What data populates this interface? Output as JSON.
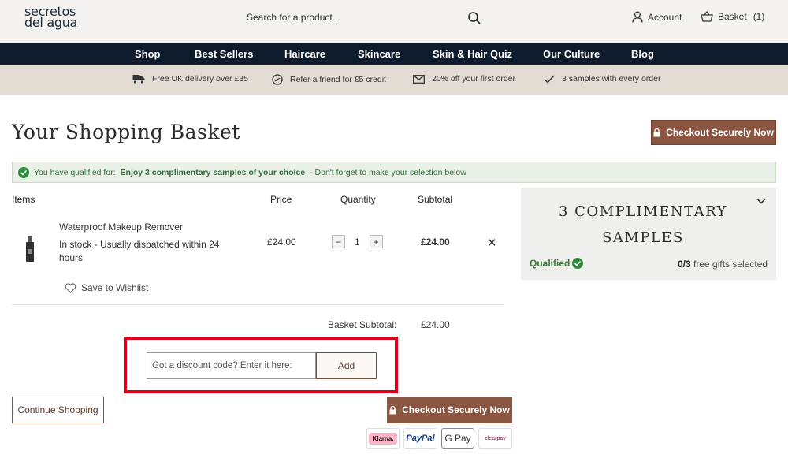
{
  "header": {
    "logo_line1": "secretos",
    "logo_line2": "del agua",
    "search_placeholder": "Search for a product...",
    "account_label": "Account",
    "basket_label": "Basket",
    "basket_count": "(1)"
  },
  "nav": {
    "items": [
      "Shop",
      "Best Sellers",
      "Haircare",
      "Skincare",
      "Skin & Hair Quiz",
      "Our Culture",
      "Blog"
    ]
  },
  "usp": {
    "items": [
      {
        "icon": "truck-icon",
        "text": "Free UK delivery over £35"
      },
      {
        "icon": "refer-icon",
        "text": "Refer a friend for £5 credit"
      },
      {
        "icon": "envelope-icon",
        "text": "20% off your first order"
      },
      {
        "icon": "check-icon",
        "text": "3 samples with every order"
      }
    ]
  },
  "page": {
    "title": "Your Shopping Basket",
    "checkout_label": "Checkout Securely Now"
  },
  "qualified_banner": {
    "prefix": "You have qualified for:",
    "offer": "Enjoy 3 complimentary samples of your choice",
    "suffix": "- Don't forget to make your selection below"
  },
  "table": {
    "headers": {
      "items": "Items",
      "price": "Price",
      "quantity": "Quantity",
      "subtotal": "Subtotal"
    }
  },
  "item": {
    "name": "Waterproof Makeup Remover",
    "stock": "In stock - Usually dispatched within 24 hours",
    "price": "£24.00",
    "quantity": "1",
    "subtotal": "£24.00",
    "wishlist_label": "Save to Wishlist"
  },
  "summary": {
    "subtotal_label": "Basket Subtotal:",
    "subtotal_value": "£24.00"
  },
  "discount": {
    "placeholder": "Got a discount code? Enter it here:",
    "button_label": "Add"
  },
  "actions": {
    "continue_label": "Continue Shopping",
    "checkout_label": "Checkout Securely Now"
  },
  "payment_methods": [
    "Klarna.",
    "PayPal",
    "G Pay",
    "clearpay"
  ],
  "samples_panel": {
    "title_line1": "3 COMPLIMENTARY",
    "title_line2": "SAMPLES",
    "qualified_label": "Qualified",
    "selected_count": "0/3",
    "selected_text": "free gifts selected"
  },
  "colors": {
    "nav_bg": "#0e1b2c",
    "accent": "#8a5642",
    "usp_bg": "#e1dbd3",
    "qualified_green": "#3a7a33",
    "highlight_red": "#e0001b"
  }
}
